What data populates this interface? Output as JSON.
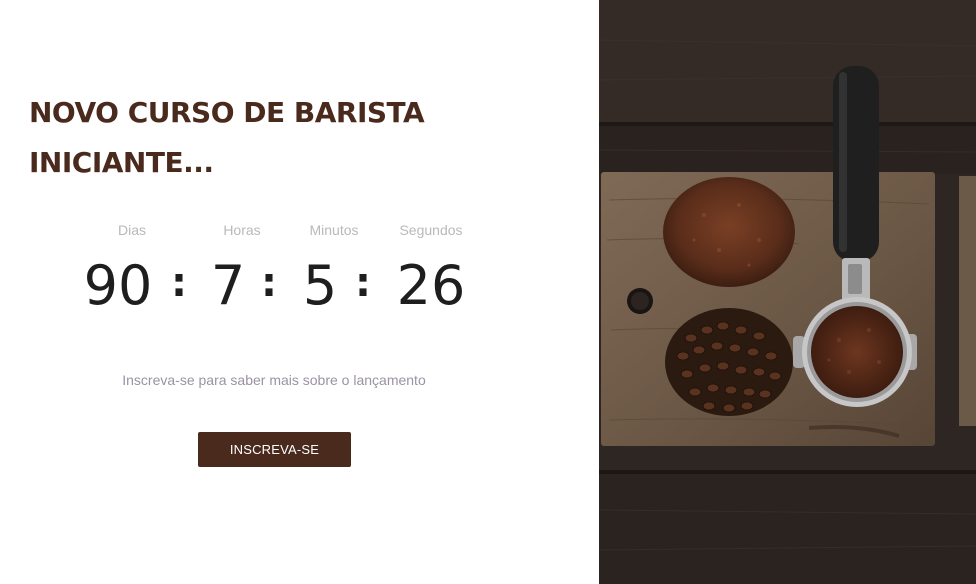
{
  "hero": {
    "title": "NOVO CURSO DE BARISTA INICIANTE...",
    "subtitle": "Inscreva-se para saber mais sobre o lançamento",
    "cta_label": "INSCREVA-SE"
  },
  "countdown": {
    "days_label": "Dias",
    "hours_label": "Horas",
    "minutes_label": "Minutos",
    "seconds_label": "Segundos",
    "days": "90",
    "hours": "7",
    "minutes": "5",
    "seconds": "26",
    "separator": ":"
  },
  "colors": {
    "accent": "#4a2a1c",
    "label": "#b9b9b9",
    "digit": "#1e1e1e",
    "subtext": "#9a93a3"
  },
  "image": {
    "subject": "coffee-photo"
  }
}
